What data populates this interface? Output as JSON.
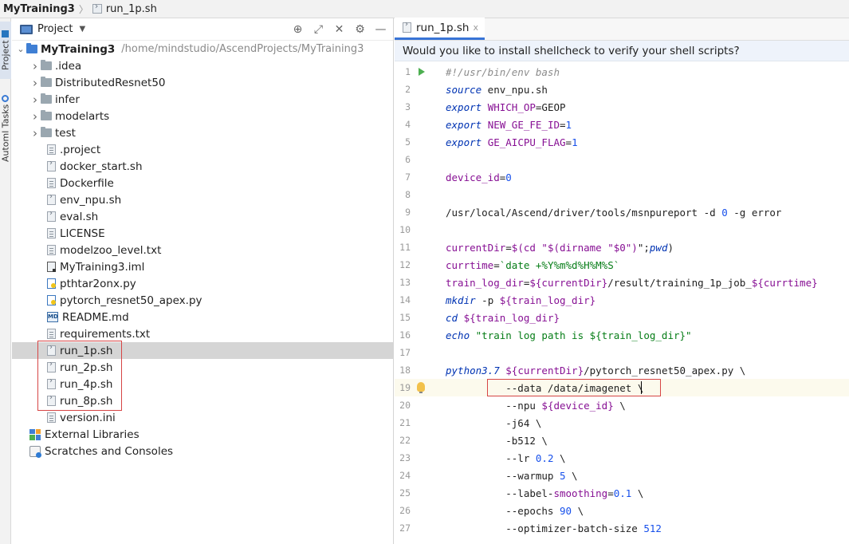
{
  "breadcrumb": {
    "project": "MyTraining3",
    "file": "run_1p.sh"
  },
  "left_strip": {
    "project_tab": "Project",
    "automl_tab": "Automl Tasks"
  },
  "project_panel": {
    "title": "Project",
    "root_name": "MyTraining3",
    "root_path": "/home/mindstudio/AscendProjects/MyTraining3",
    "items": [
      {
        "label": ".idea",
        "kind": "folder"
      },
      {
        "label": "DistributedResnet50",
        "kind": "folder"
      },
      {
        "label": "infer",
        "kind": "folder"
      },
      {
        "label": "modelarts",
        "kind": "folder"
      },
      {
        "label": "test",
        "kind": "folder"
      },
      {
        "label": ".project",
        "kind": "file"
      },
      {
        "label": "docker_start.sh",
        "kind": "sh"
      },
      {
        "label": "Dockerfile",
        "kind": "txt"
      },
      {
        "label": "env_npu.sh",
        "kind": "sh"
      },
      {
        "label": "eval.sh",
        "kind": "sh"
      },
      {
        "label": "LICENSE",
        "kind": "txt"
      },
      {
        "label": "modelzoo_level.txt",
        "kind": "txt"
      },
      {
        "label": "MyTraining3.iml",
        "kind": "iml"
      },
      {
        "label": "pthtar2onx.py",
        "kind": "py"
      },
      {
        "label": "pytorch_resnet50_apex.py",
        "kind": "py"
      },
      {
        "label": "README.md",
        "kind": "md"
      },
      {
        "label": "requirements.txt",
        "kind": "txt"
      },
      {
        "label": "run_1p.sh",
        "kind": "sh",
        "selected": true
      },
      {
        "label": "run_2p.sh",
        "kind": "sh"
      },
      {
        "label": "run_4p.sh",
        "kind": "sh"
      },
      {
        "label": "run_8p.sh",
        "kind": "sh"
      },
      {
        "label": "version.ini",
        "kind": "txt"
      }
    ],
    "external_libraries": "External Libraries",
    "scratches": "Scratches and Consoles",
    "md_badge": "MD"
  },
  "editor": {
    "tab_label": "run_1p.sh",
    "tab_close": "x",
    "banner": "Would you like to install shellcheck to verify your shell scripts?",
    "current_line": 19,
    "lines": [
      "#!/usr/bin/env bash",
      "source env_npu.sh",
      "export WHICH_OP=GEOP",
      "export NEW_GE_FE_ID=1",
      "export GE_AICPU_FLAG=1",
      "",
      "device_id=0",
      "",
      "/usr/local/Ascend/driver/tools/msnpureport -d 0 -g error",
      "",
      "currentDir=$(cd \"$(dirname \"$0\")\";pwd)",
      "currtime=`date +%Y%m%d%H%M%S`",
      "train_log_dir=${currentDir}/result/training_1p_job_${currtime}",
      "mkdir -p ${train_log_dir}",
      "cd ${train_log_dir}",
      "echo \"train log path is ${train_log_dir}\"",
      "",
      "python3.7 ${currentDir}/pytorch_resnet50_apex.py \\",
      "          --data /data/imagenet \\",
      "          --npu ${device_id} \\",
      "          -j64 \\",
      "          -b512 \\",
      "          --lr 0.2 \\",
      "          --warmup 5 \\",
      "          --label-smoothing=0.1 \\",
      "          --epochs 90 \\",
      "          --optimizer-batch-size 512"
    ]
  },
  "colors": {
    "keyword": "#0033b3",
    "comment": "#8c8c8c",
    "variable": "#871094",
    "string": "#067d17",
    "number": "#1750eb",
    "selection": "#d5d5d5",
    "highlight_box": "#d64545"
  }
}
